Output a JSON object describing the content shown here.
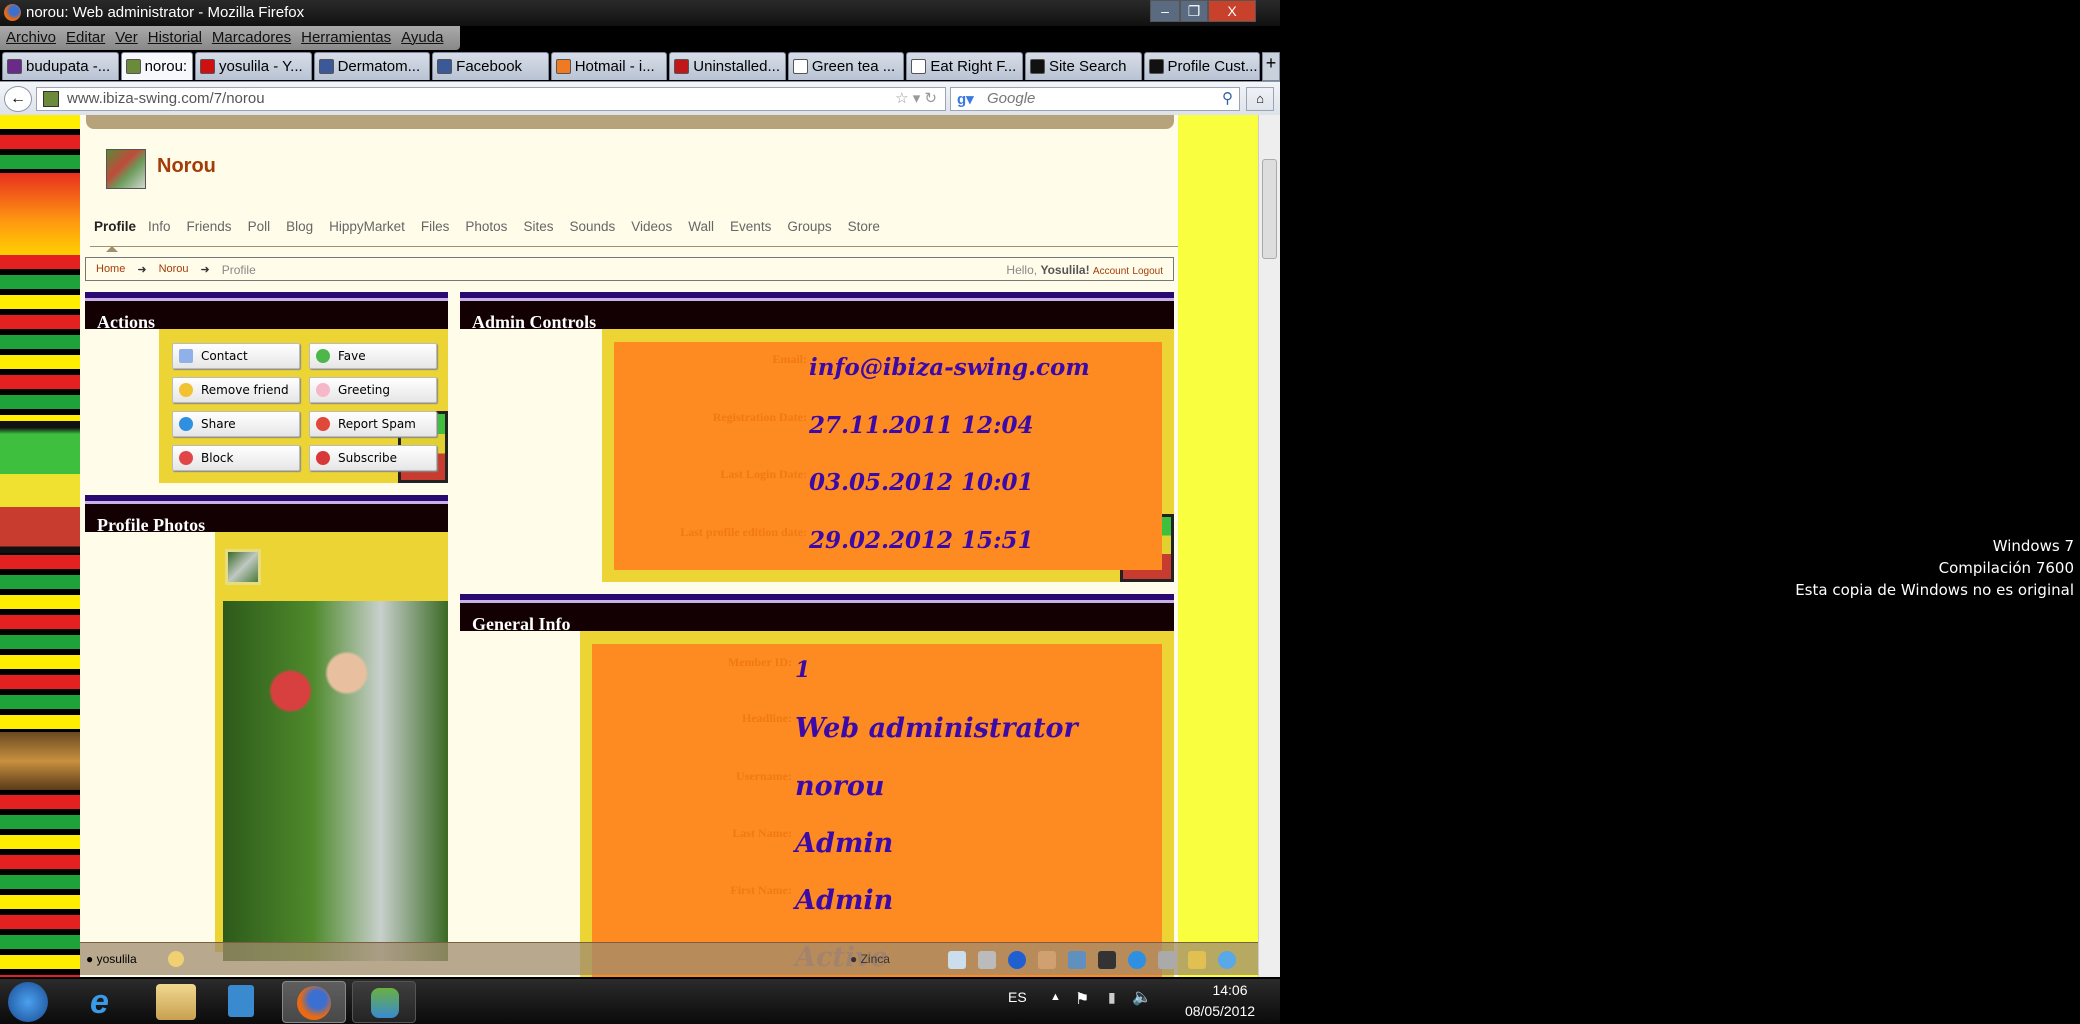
{
  "window": {
    "title": "norou: Web administrator - Mozilla Firefox",
    "controls": [
      "–",
      "❐",
      "X"
    ]
  },
  "menu": [
    "Archivo",
    "Editar",
    "Ver",
    "Historial",
    "Marcadores",
    "Herramientas",
    "Ayuda"
  ],
  "tabs": [
    {
      "label": "budupata -...",
      "color": "#6a2a8a"
    },
    {
      "label": "norou: ...",
      "color": "#6b8a3a",
      "close": "x"
    },
    {
      "label": "yosulila - Y...",
      "color": "#d01010"
    },
    {
      "label": "Dermatom...",
      "color": "#3b5998"
    },
    {
      "label": "Facebook",
      "color": "#3b5998"
    },
    {
      "label": "Hotmail - i...",
      "color": "#f07a22"
    },
    {
      "label": "Uninstalled...",
      "color": "#c01818"
    },
    {
      "label": "Green tea ...",
      "color": "#ffffff"
    },
    {
      "label": "Eat Right F...",
      "color": "#ffffff"
    },
    {
      "label": "Site Search",
      "color": "#111111"
    },
    {
      "label": "Profile Cust...",
      "color": "#111111"
    }
  ],
  "new_tab": "+",
  "url": "www.ibiza-swing.com/7/norou",
  "search_placeholder": "Google",
  "profile": {
    "name": "Norou"
  },
  "nav": [
    "Profile",
    "Info",
    "Friends",
    "Poll",
    "Blog",
    "HippyMarket",
    "Files",
    "Photos",
    "Sites",
    "Sounds",
    "Videos",
    "Wall",
    "Events",
    "Groups",
    "Store"
  ],
  "breadcrumb": {
    "home": "Home",
    "user": "Norou",
    "current": "Profile",
    "arrow": "➜",
    "hello": "Hello,",
    "username": "Yosulila!",
    "account": "Account",
    "logout": "Logout"
  },
  "actions": {
    "title": "Actions",
    "buttons": [
      {
        "label": "Contact",
        "color": "#8fb0e8"
      },
      {
        "label": "Fave",
        "color": "#4cb84c"
      },
      {
        "label": "Remove friend",
        "color": "#f2c230"
      },
      {
        "label": "Greeting",
        "color": "#f6b8c8"
      },
      {
        "label": "Share",
        "color": "#2f8fe0"
      },
      {
        "label": "Report Spam",
        "color": "#e0483a"
      },
      {
        "label": "Block",
        "color": "#e04848"
      },
      {
        "label": "Subscribe",
        "color": "#d83838"
      }
    ]
  },
  "photos": {
    "title": "Profile Photos"
  },
  "admin": {
    "title": "Admin Controls",
    "rows": [
      {
        "label": "Email:",
        "value": "info@ibiza-swing.com"
      },
      {
        "label": "Registration Date:",
        "value": "27.11.2011 12:04"
      },
      {
        "label": "Last Login Date:",
        "value": "03.05.2012 10:01"
      },
      {
        "label": "Last profile edition date:",
        "value": "29.02.2012 15:51"
      }
    ]
  },
  "general": {
    "title": "General Info",
    "rows": [
      {
        "label": "Member ID:",
        "value": "1"
      },
      {
        "label": "Headline:",
        "value": "Web administrator"
      },
      {
        "label": "Username:",
        "value": "norou"
      },
      {
        "label": "Last Name:",
        "value": "Admin"
      },
      {
        "label": "First Name:",
        "value": "Admin"
      },
      {
        "label": "",
        "value": "Active"
      }
    ]
  },
  "bottombar": {
    "user": "yosulila",
    "friend": "Zinca"
  },
  "taskbar": {
    "lang": "ES",
    "time": "14:06",
    "date": "08/05/2012"
  },
  "watermark": {
    "line1": "Windows 7",
    "line2": "Compilación  7600",
    "line3": "Esta copia de Windows no es original"
  }
}
